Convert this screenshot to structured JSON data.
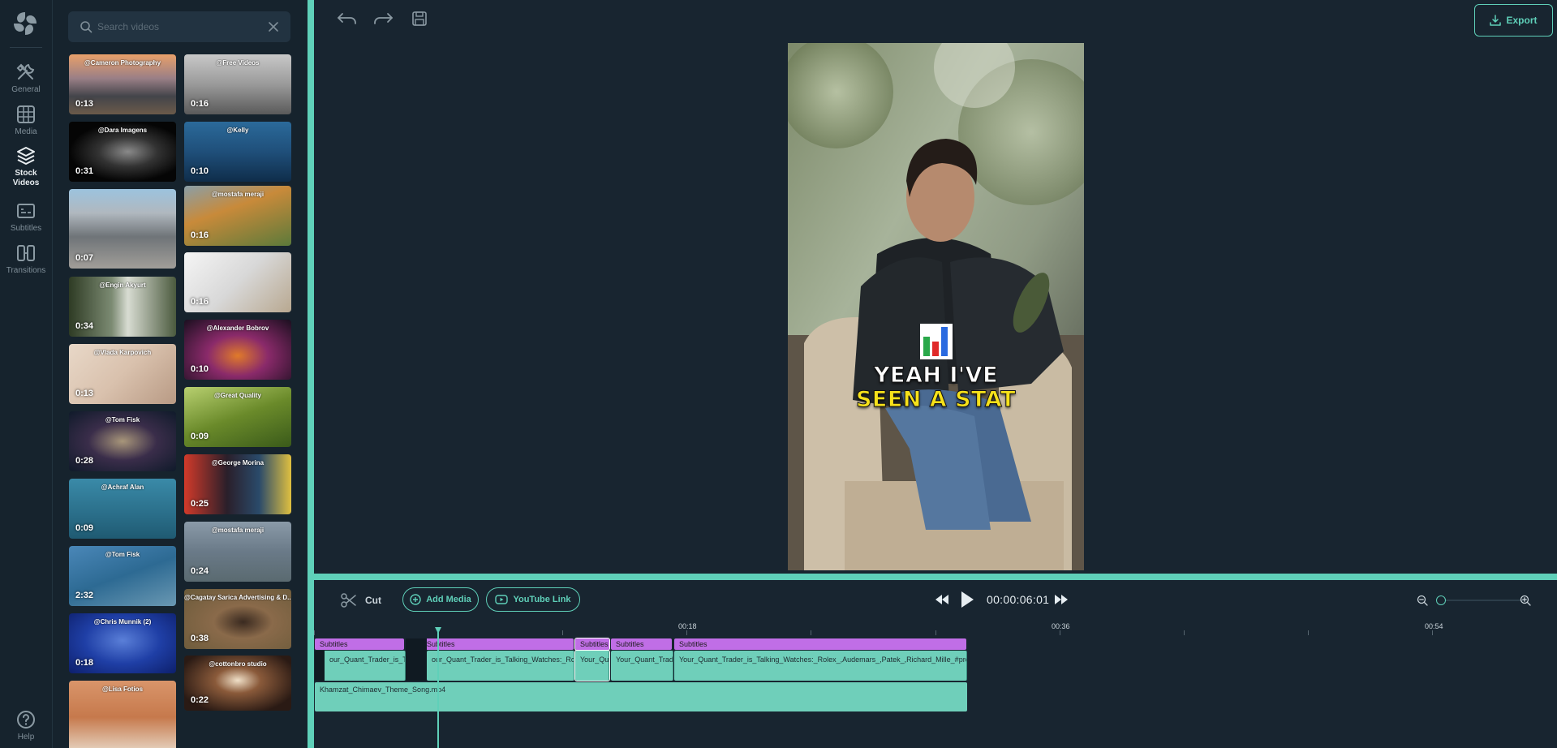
{
  "rail": {
    "items": [
      {
        "label": "General",
        "icon": "tools-icon"
      },
      {
        "label": "Media",
        "icon": "grid-icon"
      },
      {
        "label": "Stock Videos",
        "icon": "layers-icon"
      },
      {
        "label": "Subtitles",
        "icon": "subtitles-icon"
      },
      {
        "label": "Transitions",
        "icon": "transitions-icon"
      }
    ],
    "help": "Help"
  },
  "search": {
    "placeholder": "Search videos",
    "value": ""
  },
  "videos": [
    {
      "author": "@Cameron Photography",
      "duration": "0:13"
    },
    {
      "author": "@Free Videos",
      "duration": "0:16"
    },
    {
      "author": "@Dara Imagens",
      "duration": "0:31"
    },
    {
      "author": "@Kelly",
      "duration": "0:10"
    },
    {
      "author": "",
      "duration": "0:07"
    },
    {
      "author": "@mostafa meraji",
      "duration": "0:16"
    },
    {
      "author": "@Engin Akyurt",
      "duration": "0:34"
    },
    {
      "author": "",
      "duration": "0:16"
    },
    {
      "author": "@Vlada Karpovich",
      "duration": "0:13"
    },
    {
      "author": "@Alexander Bobrov",
      "duration": "0:10"
    },
    {
      "author": "@Tom Fisk",
      "duration": "0:28"
    },
    {
      "author": "@Great Quality",
      "duration": "0:09"
    },
    {
      "author": "@Achraf Alan",
      "duration": "0:09"
    },
    {
      "author": "@George Morina",
      "duration": "0:25"
    },
    {
      "author": "@Tom Fisk",
      "duration": "2:32"
    },
    {
      "author": "@mostafa meraji",
      "duration": "0:24"
    },
    {
      "author": "@Chris Munnik (2)",
      "duration": "0:18"
    },
    {
      "author": "@Cagatay Sarica Advertising & D...",
      "duration": "0:38"
    },
    {
      "author": "@Lisa Fotios",
      "duration": ""
    },
    {
      "author": "@cottonbro studio",
      "duration": "0:22"
    }
  ],
  "toolbar": {
    "export_label": "Export"
  },
  "preview": {
    "caption_line1": "YEAH I'VE",
    "caption_line2": "SEEN A STAT"
  },
  "timeline": {
    "cut_label": "Cut",
    "add_media_label": "Add Media",
    "youtube_label": "YouTube Link",
    "time": "00:00:06:01",
    "ruler": [
      "00:18",
      "00:36",
      "00:54"
    ],
    "subtitle_clips": [
      "Subtitles",
      "Subtitles",
      "Subtitles",
      "Subtitles",
      "Subtitles"
    ],
    "video_clips": [
      "our_Quant_Trader_is_Talking",
      "our_Quant_Trader_is_Talking_Watches:_Rolex_",
      "Your_Qua",
      "Your_Quant_Trade",
      "Your_Quant_Trader_is_Talking_Watches:_Rolex_,Audemars_,Patek_,Richard_Mille_#predictio"
    ],
    "audio_clip": "Khamzat_Chimaev_Theme_Song.mp4"
  }
}
